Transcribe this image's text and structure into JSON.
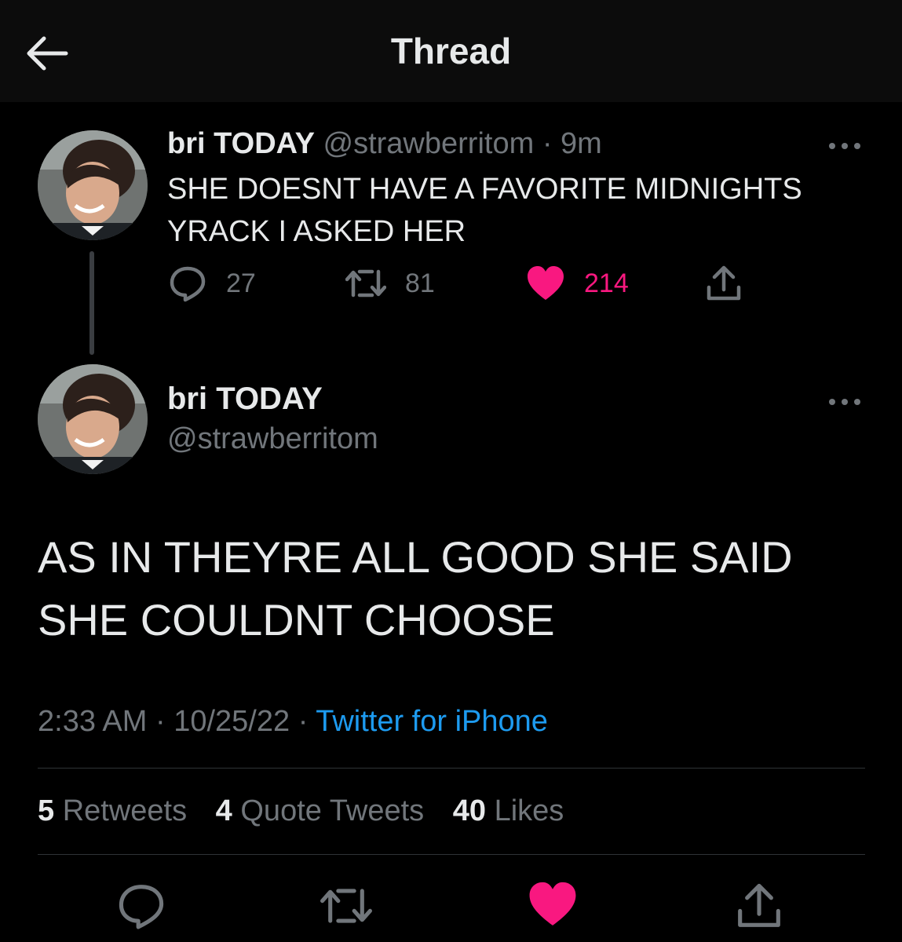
{
  "header": {
    "title": "Thread",
    "back_icon": "arrow-left-icon"
  },
  "colors": {
    "background": "#000000",
    "header_bg": "#0c0c0c",
    "text_primary": "#e7e9ea",
    "text_secondary": "#71767b",
    "accent_link": "#1d9bf0",
    "like_pink": "#f91880"
  },
  "tweet1": {
    "name": "bri TODAY",
    "handle": "@strawberritom",
    "separator": "·",
    "time": "9m",
    "text": "SHE DOESNT HAVE A FAVORITE MIDNIGHTS YRACK I ASKED HER",
    "replies": "27",
    "retweets": "81",
    "likes": "214",
    "liked": true
  },
  "tweet2": {
    "name": "bri TODAY",
    "handle": "@strawberritom",
    "text": "AS IN THEYRE ALL GOOD SHE SAID SHE COULDNT CHOOSE",
    "time": "2:33 AM",
    "separator": "·",
    "date": "10/25/22",
    "source": "Twitter for iPhone",
    "stats": {
      "retweets_num": "5",
      "retweets_label": "Retweets",
      "quotes_num": "4",
      "quotes_label": "Quote Tweets",
      "likes_num": "40",
      "likes_label": "Likes"
    }
  }
}
